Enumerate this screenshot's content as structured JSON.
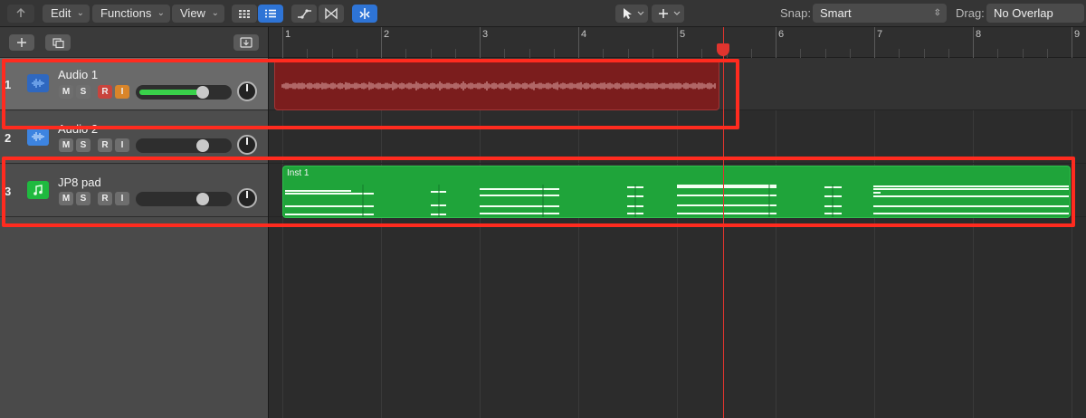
{
  "toolbar": {
    "edit_label": "Edit",
    "functions_label": "Functions",
    "view_label": "View",
    "snap_label": "Snap:",
    "snap_value": "Smart",
    "drag_label": "Drag:",
    "drag_value": "No Overlap"
  },
  "ruler": {
    "bars": [
      "1",
      "2",
      "3",
      "4",
      "5",
      "6",
      "7",
      "8",
      "9"
    ]
  },
  "tracks": [
    {
      "number": "1",
      "name": "Audio 1",
      "type": "audio",
      "mute": "M",
      "solo": "S",
      "record": "R",
      "input": "I",
      "volume_fraction": 0.72,
      "selected": true
    },
    {
      "number": "2",
      "name": "Audio 2",
      "type": "audio",
      "mute": "M",
      "solo": "S",
      "record": "R",
      "input": "I",
      "volume_fraction": 0.72,
      "selected": false
    },
    {
      "number": "3",
      "name": "JP8 pad",
      "type": "instrument",
      "mute": "M",
      "solo": "S",
      "record": "R",
      "input": "I",
      "volume_fraction": 0.72,
      "selected": false
    }
  ],
  "regions": {
    "audio1": {
      "name": ""
    },
    "inst1": {
      "name": "Inst 1"
    }
  },
  "colors": {
    "audio_region": "#7b1d1d",
    "midi_region": "#1fa43a",
    "playhead": "#e0342e",
    "highlight": "#ff2b1f",
    "accent": "#2e74d6"
  },
  "icons": {
    "back": "back-arrow-icon",
    "grid_view": "grid-view-icon",
    "list_view": "list-view-icon",
    "automation": "automation-icon",
    "flex": "flex-icon",
    "catch": "catch-icon",
    "pointer": "pointer-tool-icon",
    "pencil": "pencil-tool-icon",
    "add": "add-track-icon",
    "duplicate": "duplicate-track-icon",
    "import": "import-icon"
  }
}
